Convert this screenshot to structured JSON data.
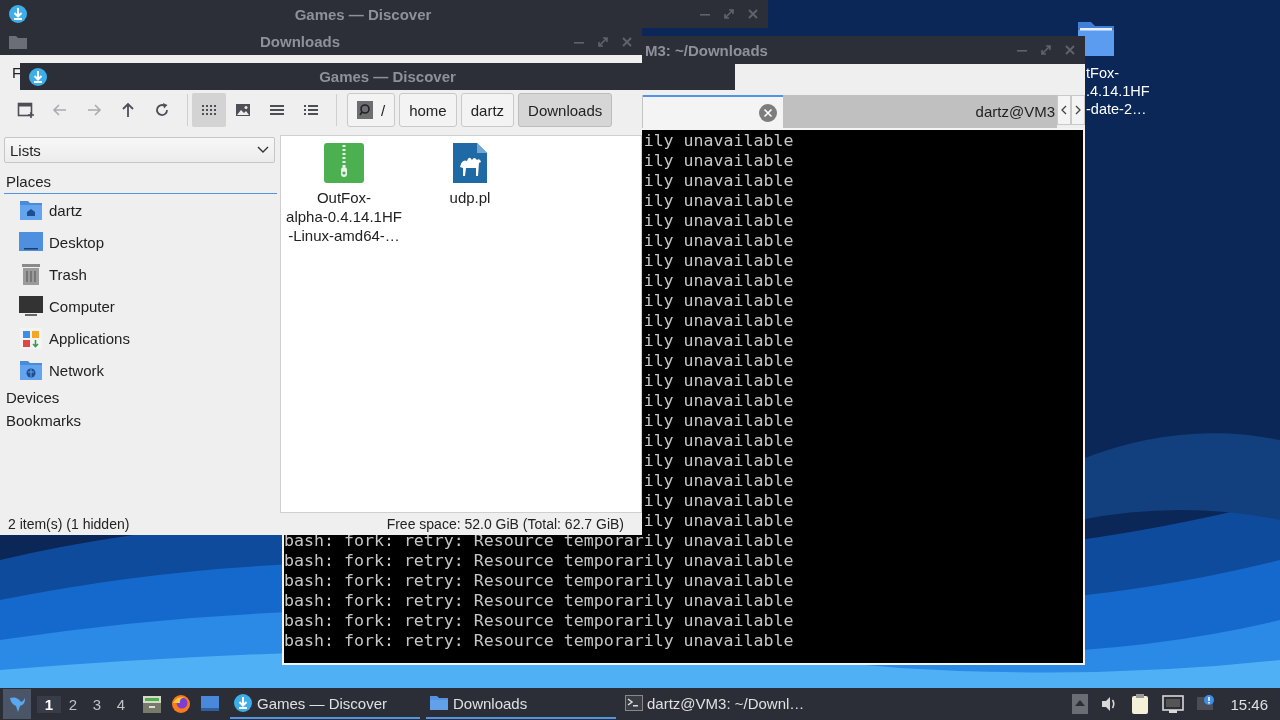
{
  "back_window": {
    "title": "Games — Discover"
  },
  "file_manager": {
    "title": "Downloads",
    "menu": [
      "F"
    ],
    "nav": [
      {
        "kind": "new-tab",
        "disabled": false
      },
      {
        "kind": "back",
        "disabled": true
      },
      {
        "kind": "forward",
        "disabled": true
      },
      {
        "kind": "up",
        "disabled": false
      },
      {
        "kind": "reload",
        "disabled": false
      }
    ],
    "view_modes": [
      {
        "kind": "icons",
        "selected": true
      },
      {
        "kind": "thumbnails",
        "selected": false
      },
      {
        "kind": "compact",
        "selected": false
      },
      {
        "kind": "details",
        "selected": false
      }
    ],
    "path": [
      {
        "kind": "root",
        "label": "/",
        "selected": false
      },
      {
        "kind": "dir",
        "label": "home",
        "selected": false
      },
      {
        "kind": "dir",
        "label": "dartz",
        "selected": false
      },
      {
        "kind": "dir",
        "label": "Downloads",
        "selected": true
      }
    ],
    "side_pane": {
      "dropdown": "Lists",
      "sections": [
        {
          "title": "Places",
          "items": [
            {
              "kind": "home",
              "label": "dartz"
            },
            {
              "kind": "desktop",
              "label": "Desktop"
            },
            {
              "kind": "trash",
              "label": "Trash"
            },
            {
              "kind": "computer",
              "label": "Computer"
            },
            {
              "kind": "applications",
              "label": "Applications"
            },
            {
              "kind": "network",
              "label": "Network"
            }
          ]
        },
        {
          "title": "Devices"
        },
        {
          "title": "Bookmarks"
        }
      ]
    },
    "files": [
      {
        "kind": "archive",
        "name": "OutFox-\nalpha-0.4.14.1HF\n-Linux-amd64-…"
      },
      {
        "kind": "perl",
        "name": "udp.pl"
      }
    ],
    "status_bar": {
      "items": "2 item(s) (1 hidden)",
      "free_space": "Free space: 52.0 GiB (Total: 62.7 GiB)"
    }
  },
  "overlay_window": {
    "title": "Games — Discover"
  },
  "terminal": {
    "title": "M3: ~/Downloads",
    "tabs": [
      {
        "selected": true
      },
      {
        "label": "dartz@VM3",
        "selected": false
      }
    ],
    "lines": [
      "ily unavailable",
      "ily unavailable",
      "ily unavailable",
      "ily unavailable",
      "ily unavailable",
      "ily unavailable",
      "ily unavailable",
      "ily unavailable",
      "ily unavailable",
      "ily unavailable",
      "ily unavailable",
      "ily unavailable",
      "ily unavailable",
      "ily unavailable",
      "ily unavailable",
      "ily unavailable",
      "ily unavailable",
      "ily unavailable",
      "ily unavailable",
      "ily unavailable",
      "bash: fork: retry: Resource temporarily unavailable",
      "bash: fork: retry: Resource temporarily unavailable",
      "bash: fork: retry: Resource temporarily unavailable",
      "bash: fork: retry: Resource temporarily unavailable",
      "bash: fork: retry: Resource temporarily unavailable",
      "bash: fork: retry: Resource temporarily unavailable"
    ]
  },
  "desktop_icons": [
    {
      "label": "tFox-\n.4.14.1HF\n-date-2…"
    }
  ],
  "taskbar": {
    "workspaces": [
      {
        "label": "1",
        "selected": true
      },
      {
        "label": "2",
        "selected": false
      },
      {
        "label": "3",
        "selected": false
      },
      {
        "label": "4",
        "selected": false
      }
    ],
    "launchers": [
      {
        "kind": "files"
      },
      {
        "kind": "browser"
      },
      {
        "kind": "desktop"
      }
    ],
    "tasks": [
      {
        "kind": "discover",
        "label": "Games — Discover",
        "selected": true
      },
      {
        "kind": "folder",
        "label": "Downloads",
        "selected": true
      },
      {
        "kind": "terminal",
        "label": "dartz@VM3: ~/Downl…",
        "selected": false
      }
    ],
    "tray": [
      {
        "kind": "hidden-icons"
      },
      {
        "kind": "volume"
      },
      {
        "kind": "clipboard"
      },
      {
        "kind": "network"
      },
      {
        "kind": "notification"
      }
    ],
    "clock": "15:46"
  }
}
